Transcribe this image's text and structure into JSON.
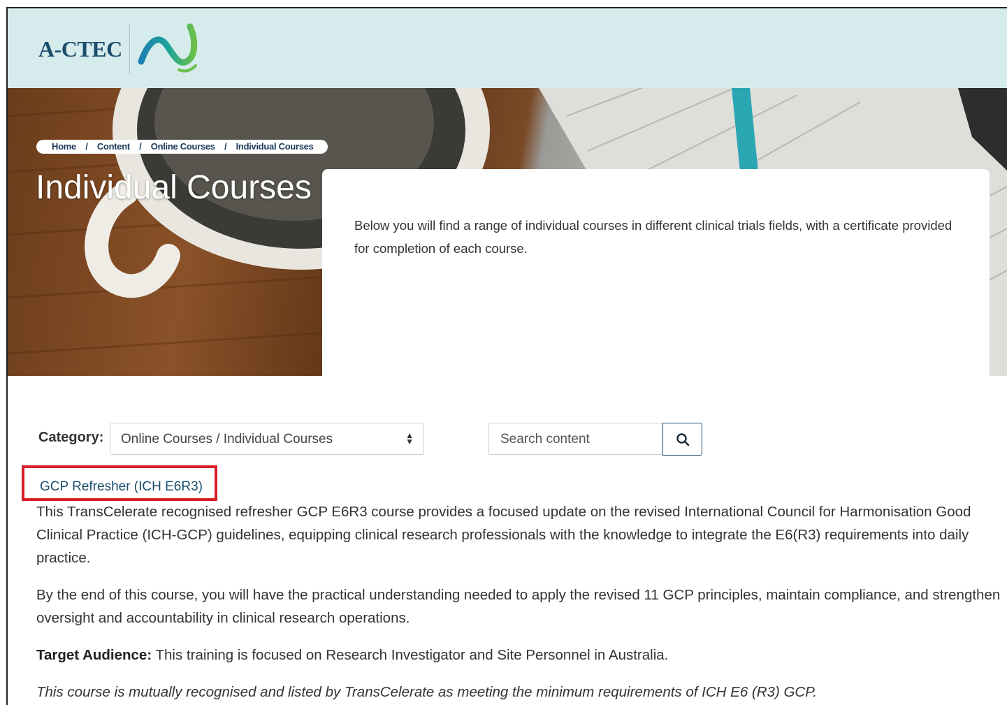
{
  "brand": {
    "logo_text": "A-CTEC"
  },
  "breadcrumb": {
    "items": [
      "Home",
      "Content",
      "Online Courses",
      "Individual Courses"
    ],
    "separator": "/"
  },
  "page": {
    "title": "Individual Courses",
    "intro": "Below you will find a range of individual courses in different clinical trials fields, with a certificate provided for completion of each course."
  },
  "filters": {
    "category_label": "Category:",
    "category_value": "Online Courses / Individual Courses",
    "search_placeholder": "Search content"
  },
  "course": {
    "title": "GCP Refresher (ICH E6R3)",
    "paragraph1": "This TransCelerate recognised refresher GCP E6R3 course provides a focused update on the revised International Council for Harmonisation Good Clinical Practice (ICH-GCP) guidelines, equipping clinical research professionals with the knowledge to integrate the E6(R3) requirements into daily practice.",
    "paragraph2": "By the end of this course, you will have the practical understanding needed to apply the revised 11 GCP principles, maintain compliance, and strengthen oversight and accountability in clinical research operations.",
    "audience_label": "Target Audience:",
    "audience_text": " This training is focused on Research Investigator and Site Personnel in Australia.",
    "recognition_note": "This course is mutually recognised and listed by TransCelerate as meeting the minimum requirements of ICH E6 (R3) GCP."
  },
  "colors": {
    "header_bg": "#d6ecec",
    "brand_navy": "#1b4d6e",
    "highlight_red": "#d61f26"
  }
}
